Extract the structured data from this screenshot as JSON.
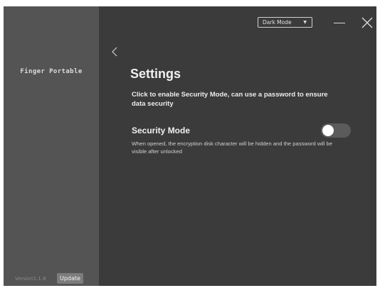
{
  "sidebar": {
    "app_name": "Finger Portable",
    "version": "Version1.1.8",
    "update_label": "Update"
  },
  "titlebar": {
    "theme_select": {
      "selected": "Dark Mode",
      "caret": "▼"
    }
  },
  "settings": {
    "title": "Settings",
    "intro": "Click to enable  Security Mode, can use a password to ensure data security",
    "security_mode": {
      "label": "Security Mode",
      "description": "When opened, the encryption disk character will be hidden and the password will be visible after unlocked",
      "enabled": false
    }
  },
  "colors": {
    "main_background": "#3b3b3b",
    "sidebar_background": "#545454",
    "toggle_off": "#5b5b5b",
    "text_primary": "#f0f0f0"
  },
  "icons": {
    "back": "chevron-left-icon",
    "minimize": "minimize-icon",
    "close": "close-icon",
    "dropdown": "caret-down-icon"
  }
}
